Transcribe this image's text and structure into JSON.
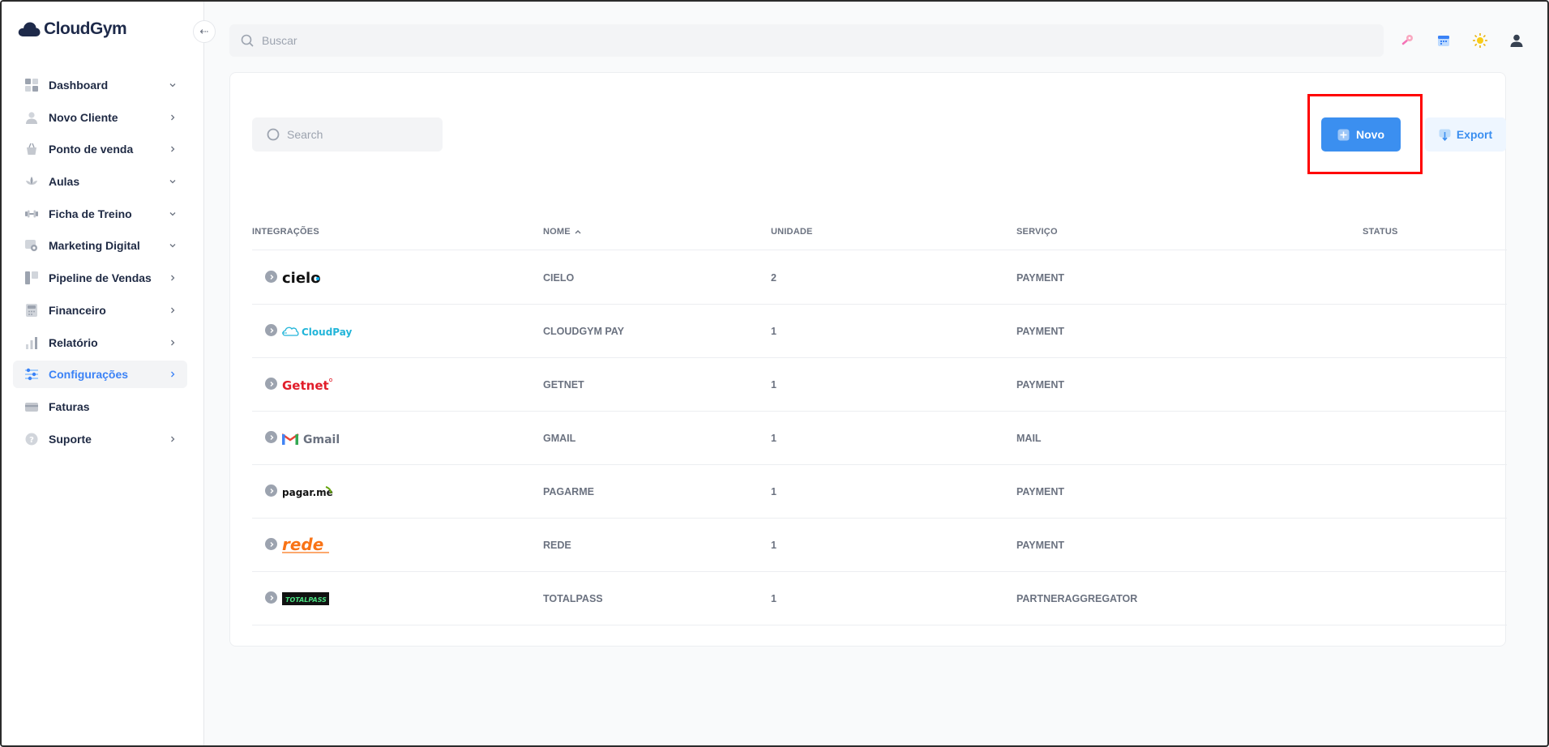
{
  "app": {
    "brand": "CloudGym"
  },
  "topbar": {
    "search_placeholder": "Buscar"
  },
  "sidebar": {
    "items": [
      {
        "label": "Dashboard",
        "icon": "dashboard-icon",
        "chevron": "down"
      },
      {
        "label": "Novo Cliente",
        "icon": "user-icon",
        "chevron": "right"
      },
      {
        "label": "Ponto de venda",
        "icon": "basket-icon",
        "chevron": "right"
      },
      {
        "label": "Aulas",
        "icon": "lotus-icon",
        "chevron": "down"
      },
      {
        "label": "Ficha de Treino",
        "icon": "dumbbell-icon",
        "chevron": "down"
      },
      {
        "label": "Marketing Digital",
        "icon": "marketing-icon",
        "chevron": "down"
      },
      {
        "label": "Pipeline de Vendas",
        "icon": "pipeline-icon",
        "chevron": "right"
      },
      {
        "label": "Financeiro",
        "icon": "calculator-icon",
        "chevron": "right"
      },
      {
        "label": "Relatório",
        "icon": "chart-icon",
        "chevron": "right"
      },
      {
        "label": "Configurações",
        "icon": "sliders-icon",
        "chevron": "right",
        "active": true
      },
      {
        "label": "Faturas",
        "icon": "card-icon",
        "chevron": ""
      },
      {
        "label": "Suporte",
        "icon": "help-icon",
        "chevron": "right"
      }
    ]
  },
  "table": {
    "search_placeholder": "Search",
    "new_label": "Novo",
    "export_label": "Export",
    "headers": {
      "integrations": "INTEGRAÇÕES",
      "name": "NOME",
      "unit": "UNIDADE",
      "service": "SERVIÇO",
      "status": "STATUS"
    },
    "rows": [
      {
        "logo": "cielo",
        "logo_text": "cielo",
        "name": "CIELO",
        "unit": "2",
        "service": "PAYMENT"
      },
      {
        "logo": "cloudpay",
        "logo_text": "CloudPay",
        "name": "CLOUDGYM PAY",
        "unit": "1",
        "service": "PAYMENT"
      },
      {
        "logo": "getnet",
        "logo_text": "Getnet",
        "name": "GETNET",
        "unit": "1",
        "service": "PAYMENT"
      },
      {
        "logo": "gmail",
        "logo_text": "Gmail",
        "name": "GMAIL",
        "unit": "1",
        "service": "MAIL"
      },
      {
        "logo": "pagarme",
        "logo_text": "pagar.me",
        "name": "PAGARME",
        "unit": "1",
        "service": "PAYMENT"
      },
      {
        "logo": "rede",
        "logo_text": "rede",
        "name": "REDE",
        "unit": "1",
        "service": "PAYMENT"
      },
      {
        "logo": "totalpass",
        "logo_text": "TOTALPASS",
        "name": "TOTALPASS",
        "unit": "1",
        "service": "PARTNERAGGREGATOR"
      }
    ]
  },
  "colors": {
    "accent": "#3b8ff0",
    "active_nav": "#3b82f6",
    "highlight": "#ff0000"
  }
}
